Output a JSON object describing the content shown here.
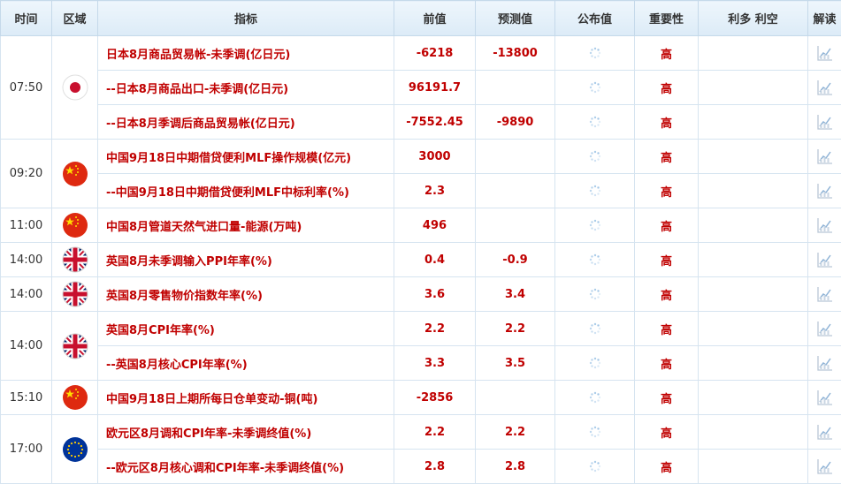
{
  "headers": [
    "时间",
    "区域",
    "指标",
    "前值",
    "预测值",
    "公布值",
    "重要性",
    "利多 利空",
    "解读"
  ],
  "groups": [
    {
      "time": "07:50",
      "flag": "japan-flag",
      "rows": [
        {
          "indicator": "日本8月商品贸易帐-未季调(亿日元)",
          "previous": "-6218",
          "forecast": "-13800",
          "actual": "",
          "importance": "高"
        },
        {
          "indicator": "--日本8月商品出口-未季调(亿日元)",
          "previous": "96191.7",
          "forecast": "",
          "actual": "",
          "importance": "高"
        },
        {
          "indicator": "--日本8月季调后商品贸易帐(亿日元)",
          "previous": "-7552.45",
          "forecast": "-9890",
          "actual": "",
          "importance": "高"
        }
      ]
    },
    {
      "time": "09:20",
      "flag": "china-flag",
      "rows": [
        {
          "indicator": "中国9月18日中期借贷便利MLF操作规模(亿元)",
          "previous": "3000",
          "forecast": "",
          "actual": "",
          "importance": "高"
        },
        {
          "indicator": "--中国9月18日中期借贷便利MLF中标利率(%)",
          "previous": "2.3",
          "forecast": "",
          "actual": "",
          "importance": "高"
        }
      ]
    },
    {
      "time": "11:00",
      "flag": "china-flag",
      "rows": [
        {
          "indicator": "中国8月管道天然气进口量-能源(万吨)",
          "previous": "496",
          "forecast": "",
          "actual": "",
          "importance": "高"
        }
      ]
    },
    {
      "time": "14:00",
      "flag": "uk-flag",
      "rows": [
        {
          "indicator": "英国8月未季调输入PPI年率(%)",
          "previous": "0.4",
          "forecast": "-0.9",
          "actual": "",
          "importance": "高"
        }
      ]
    },
    {
      "time": "14:00",
      "flag": "uk-flag",
      "rows": [
        {
          "indicator": "英国8月零售物价指数年率(%)",
          "previous": "3.6",
          "forecast": "3.4",
          "actual": "",
          "importance": "高"
        }
      ]
    },
    {
      "time": "14:00",
      "flag": "uk-flag",
      "rows": [
        {
          "indicator": "英国8月CPI年率(%)",
          "previous": "2.2",
          "forecast": "2.2",
          "actual": "",
          "importance": "高"
        },
        {
          "indicator": "--英国8月核心CPI年率(%)",
          "previous": "3.3",
          "forecast": "3.5",
          "actual": "",
          "importance": "高"
        }
      ]
    },
    {
      "time": "15:10",
      "flag": "china-flag",
      "rows": [
        {
          "indicator": "中国9月18日上期所每日仓单变动-铜(吨)",
          "previous": "-2856",
          "forecast": "",
          "actual": "",
          "importance": "高"
        }
      ]
    },
    {
      "time": "17:00",
      "flag": "eu-flag",
      "rows": [
        {
          "indicator": "欧元区8月调和CPI年率-未季调终值(%)",
          "previous": "2.2",
          "forecast": "2.2",
          "actual": "",
          "importance": "高"
        },
        {
          "indicator": "--欧元区8月核心调和CPI年率-未季调终值(%)",
          "previous": "2.8",
          "forecast": "2.8",
          "actual": "",
          "importance": "高"
        }
      ]
    }
  ],
  "colors": {
    "accent_red": "#c00000",
    "header_bg": "#dcebf7",
    "border": "#d6e4f0"
  }
}
